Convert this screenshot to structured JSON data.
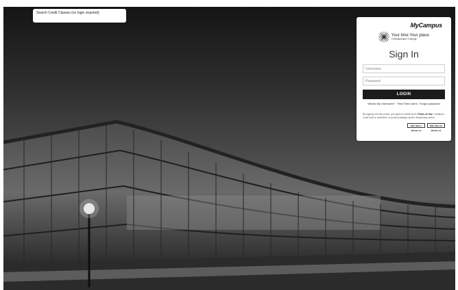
{
  "search_link": {
    "label": "Search Credit Classes (no login required)"
  },
  "login_panel": {
    "brand": "MyCampus",
    "tagline": "Your time Your place.",
    "college": "Chesapeake College",
    "title": "Sign In",
    "username_placeholder": "Username",
    "password_placeholder": "Password",
    "login_label": "LOGIN",
    "links": [
      {
        "label": "What's My Username?"
      },
      {
        "label": "First Time Users"
      },
      {
        "label": "Forgot password"
      }
    ],
    "disclaimer_prefix": "By signing into this portal, you agree to abide by its ",
    "terms_link": "Terms of Use.",
    "disclaimer_suffix": " Violations could lead to restriction of portal privileges and/or disciplinary action.",
    "badges": [
      "W3C WAI-A WCAG 2.0",
      "W3C WAI-AA WCAG 2.0"
    ]
  },
  "icons": {
    "logo": "starburst-icon"
  }
}
